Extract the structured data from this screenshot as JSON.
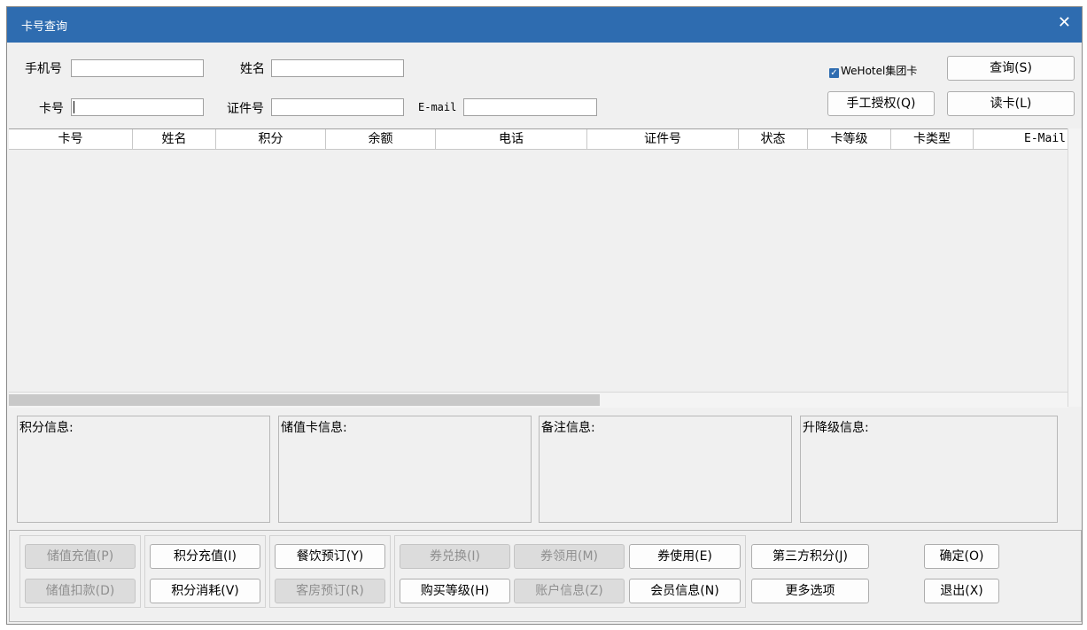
{
  "window": {
    "title": "卡号查询",
    "close_symbol": "✕"
  },
  "form": {
    "phone_label": "手机号",
    "name_label": "姓名",
    "card_label": "卡号",
    "id_label": "证件号",
    "email_label": "E-mail",
    "phone_value": "",
    "name_value": "",
    "card_value": "",
    "id_value": "",
    "email_value": "",
    "wehotel_checkbox_label": "WeHotel集团卡",
    "wehotel_checked": true
  },
  "top_buttons": {
    "query": "查询(S)",
    "manual_auth": "手工授权(Q)",
    "read_card": "读卡(L)"
  },
  "table": {
    "columns": [
      "卡号",
      "姓名",
      "积分",
      "余额",
      "电话",
      "证件号",
      "状态",
      "卡等级",
      "卡类型",
      "E-Mail"
    ],
    "rows": []
  },
  "panels": {
    "points_info": "积分信息:",
    "stored_value_info": "储值卡信息:",
    "remarks_info": "备注信息:",
    "level_change_info": "升降级信息:"
  },
  "buttons": {
    "stored_value_recharge": "储值充值(P)",
    "stored_value_deduct": "储值扣款(D)",
    "points_recharge": "积分充值(I)",
    "points_consume": "积分消耗(V)",
    "dining_booking": "餐饮预订(Y)",
    "room_booking": "客房预订(R)",
    "voucher_exchange": "券兑换(I)",
    "buy_level": "购买等级(H)",
    "voucher_claim": "券领用(M)",
    "account_info": "账户信息(Z)",
    "voucher_use": "券使用(E)",
    "member_info": "会员信息(N)",
    "third_party_points": "第三方积分(J)",
    "more_options": "更多选项",
    "confirm": "确定(O)",
    "exit": "退出(X)"
  }
}
